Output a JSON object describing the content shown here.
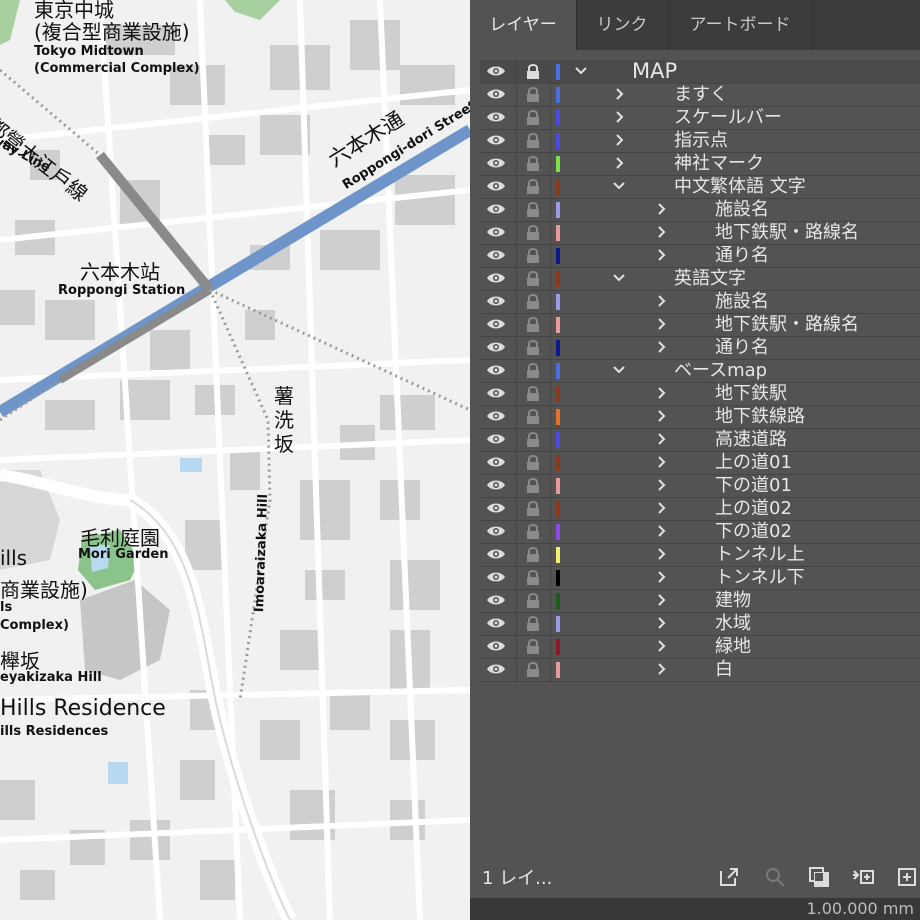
{
  "map": {
    "labels": {
      "midtown_jp_1": "東京中城",
      "midtown_jp_2": "(複合型商業設施)",
      "midtown_en_1": "Tokyo Midtown",
      "midtown_en_2": "(Commercial Complex)",
      "oedo_jp": "都營大江戶線",
      "oedo_en": "way Line",
      "roppongi_dori_jp": "六本木通",
      "roppongi_dori_en": "Roppongi-dori Street",
      "station_jp": "六本木站",
      "station_en": "Roppongi Station",
      "imoarai_jp": "薯洗坂",
      "imoarai_en": "Imoaraizaka Hill",
      "mori_jp": "毛利庭園",
      "mori_en": "Mori Garden",
      "hills_jp_1": "ills",
      "hills_jp_2": "商業設施)",
      "hills_en_1": "ls",
      "hills_en_2": "Complex)",
      "keyaki_jp": "櫸坂",
      "keyaki_en": "eyakizaka Hill",
      "residence_jp": "Hills Residence",
      "residence_en": "ills Residences"
    }
  },
  "panel": {
    "tabs": [
      "レイヤー",
      "リンク",
      "アートボード"
    ],
    "active_tab": 0,
    "layers": [
      {
        "name": "MAP",
        "level": 0,
        "expanded": true,
        "color": "#4a6ee0",
        "selected": true
      },
      {
        "name": "ますく",
        "level": 1,
        "expanded": false,
        "color": "#4a6ee0"
      },
      {
        "name": "スケールバー",
        "level": 1,
        "expanded": false,
        "color": "#4a4ae8"
      },
      {
        "name": "指示点",
        "level": 1,
        "expanded": false,
        "color": "#4a4ae8"
      },
      {
        "name": "神社マーク",
        "level": 1,
        "expanded": false,
        "color": "#7ee04a"
      },
      {
        "name": "中文繁体語 文字",
        "level": 1,
        "expanded": true,
        "color": "#8a3a1a"
      },
      {
        "name": "施設名",
        "level": 2,
        "expanded": false,
        "color": "#9a9ae8"
      },
      {
        "name": "地下鉄駅・路線名",
        "level": 2,
        "expanded": false,
        "color": "#e89a9a"
      },
      {
        "name": "通り名",
        "level": 2,
        "expanded": false,
        "color": "#0a1a8a"
      },
      {
        "name": "英語文字",
        "level": 1,
        "expanded": true,
        "color": "#8a3a1a"
      },
      {
        "name": "施設名",
        "level": 2,
        "expanded": false,
        "color": "#9a9ae8"
      },
      {
        "name": "地下鉄駅・路線名",
        "level": 2,
        "expanded": false,
        "color": "#e89a9a"
      },
      {
        "name": "通り名",
        "level": 2,
        "expanded": false,
        "color": "#0a1a8a"
      },
      {
        "name": "ベースmap",
        "level": 1,
        "expanded": true,
        "color": "#4a6ee0"
      },
      {
        "name": "地下鉄駅",
        "level": 2,
        "expanded": false,
        "color": "#8a3a1a"
      },
      {
        "name": "地下鉄線路",
        "level": 2,
        "expanded": false,
        "color": "#e8702a"
      },
      {
        "name": "高速道路",
        "level": 2,
        "expanded": false,
        "color": "#4a4ae8"
      },
      {
        "name": "上の道01",
        "level": 2,
        "expanded": false,
        "color": "#8a3a1a"
      },
      {
        "name": "下の道01",
        "level": 2,
        "expanded": false,
        "color": "#e89a9a"
      },
      {
        "name": "上の道02",
        "level": 2,
        "expanded": false,
        "color": "#8a3a1a"
      },
      {
        "name": "下の道02",
        "level": 2,
        "expanded": false,
        "color": "#8a4ae8"
      },
      {
        "name": "トンネル上",
        "level": 2,
        "expanded": false,
        "color": "#f0f070"
      },
      {
        "name": "トンネル下",
        "level": 2,
        "expanded": false,
        "color": "#000000"
      },
      {
        "name": "建物",
        "level": 2,
        "expanded": false,
        "color": "#1a5a1a"
      },
      {
        "name": "水域",
        "level": 2,
        "expanded": false,
        "color": "#9a9ae8"
      },
      {
        "name": "緑地",
        "level": 2,
        "expanded": false,
        "color": "#8a1a2a"
      },
      {
        "name": "白",
        "level": 2,
        "expanded": false,
        "color": "#e89a9a"
      }
    ],
    "footer": {
      "layer_count": "1 レイ...",
      "icons": [
        "export-icon",
        "search-icon",
        "clip-mask-icon",
        "new-sublayer-icon",
        "new-layer-icon"
      ]
    },
    "bottom_text": "1.00.000 mm"
  }
}
